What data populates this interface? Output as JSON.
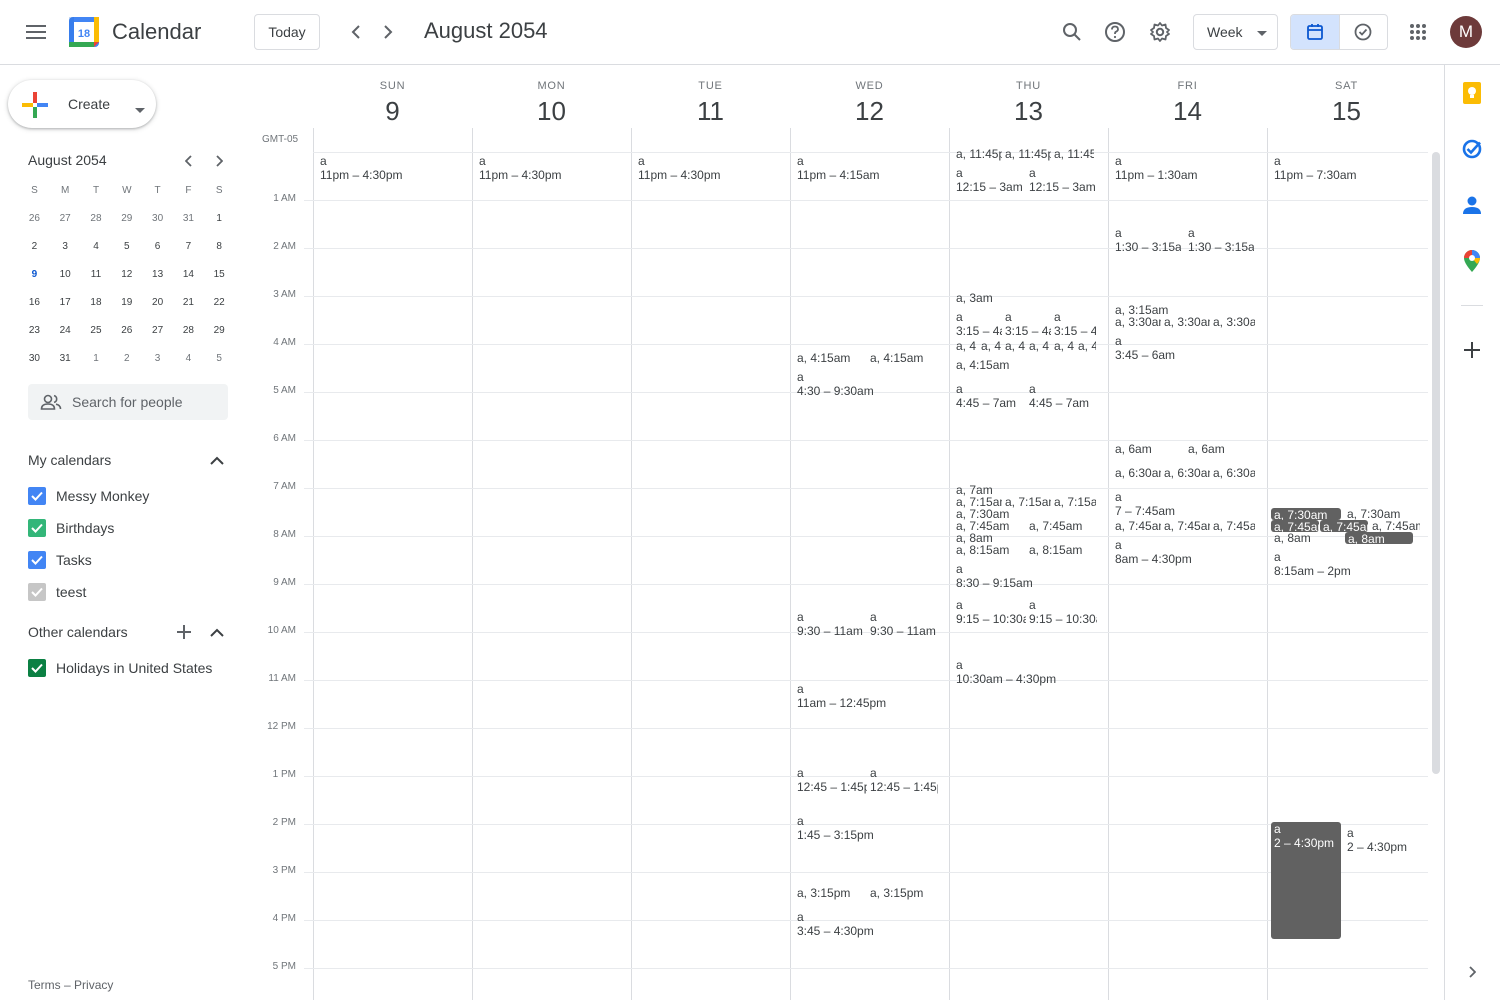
{
  "header": {
    "app_title": "Calendar",
    "logo_day": "18",
    "today_label": "Today",
    "period": "August 2054",
    "view_select": "Week",
    "avatar_letter": "M"
  },
  "sidebar": {
    "create_label": "Create",
    "mini_cal": {
      "title": "August 2054",
      "dow": [
        "S",
        "M",
        "T",
        "W",
        "T",
        "F",
        "S"
      ],
      "weeks": [
        [
          "26",
          "27",
          "28",
          "29",
          "30",
          "31",
          "1"
        ],
        [
          "2",
          "3",
          "4",
          "5",
          "6",
          "7",
          "8"
        ],
        [
          "9",
          "10",
          "11",
          "12",
          "13",
          "14",
          "15"
        ],
        [
          "16",
          "17",
          "18",
          "19",
          "20",
          "21",
          "22"
        ],
        [
          "23",
          "24",
          "25",
          "26",
          "27",
          "28",
          "29"
        ],
        [
          "30",
          "31",
          "1",
          "2",
          "3",
          "4",
          "5"
        ]
      ]
    },
    "search_people_placeholder": "Search for people",
    "my_calendars": {
      "title": "My calendars",
      "items": [
        {
          "label": "Messy Monkey",
          "color": "#4285f4",
          "checked": true
        },
        {
          "label": "Birthdays",
          "color": "#33b679",
          "checked": true
        },
        {
          "label": "Tasks",
          "color": "#4285f4",
          "checked": true
        },
        {
          "label": "teest",
          "color": "#c6c6c6",
          "checked": true
        }
      ]
    },
    "other_calendars": {
      "title": "Other calendars",
      "items": [
        {
          "label": "Holidays in United States",
          "color": "#0b8043",
          "checked": true
        }
      ]
    },
    "footer": {
      "terms": "Terms",
      "sep": "–",
      "privacy": "Privacy"
    }
  },
  "week": {
    "timezone": "GMT-05",
    "days": [
      {
        "dow": "SUN",
        "num": "9"
      },
      {
        "dow": "MON",
        "num": "10"
      },
      {
        "dow": "TUE",
        "num": "11"
      },
      {
        "dow": "WED",
        "num": "12"
      },
      {
        "dow": "THU",
        "num": "13"
      },
      {
        "dow": "FRI",
        "num": "14"
      },
      {
        "dow": "SAT",
        "num": "15"
      }
    ],
    "hours": [
      "1 AM",
      "2 AM",
      "3 AM",
      "4 AM",
      "5 AM",
      "6 AM",
      "7 AM",
      "8 AM",
      "9 AM",
      "10 AM",
      "11 AM",
      "12 PM",
      "1 PM",
      "2 PM",
      "3 PM",
      "4 PM",
      "5 PM"
    ]
  },
  "events": [
    {
      "day": 0,
      "title": "a",
      "time": "11pm – 4:30pm"
    },
    {
      "day": 1,
      "title": "a",
      "time": "11pm – 4:30pm"
    },
    {
      "day": 2,
      "title": "a",
      "time": "11pm – 4:30pm"
    },
    {
      "day": 3,
      "title": "a",
      "time": "11pm – 4:15am"
    },
    {
      "day": 3,
      "text": "a, 4:15am"
    },
    {
      "day": 3,
      "text": "a, 4:15am"
    },
    {
      "day": 3,
      "title": "a",
      "time": "4:30 – 9:30am"
    },
    {
      "day": 3,
      "title": "a",
      "time": "9:30 – 11am"
    },
    {
      "day": 3,
      "title": "a",
      "time": "9:30 – 11am"
    },
    {
      "day": 3,
      "title": "a",
      "time": "11am – 12:45pm"
    },
    {
      "day": 3,
      "title": "a",
      "time": "12:45 – 1:45pm"
    },
    {
      "day": 3,
      "title": "a",
      "time": "12:45 – 1:45pm"
    },
    {
      "day": 3,
      "title": "a",
      "time": "1:45 – 3:15pm"
    },
    {
      "day": 3,
      "text": "a, 3:15pm"
    },
    {
      "day": 3,
      "text": "a, 3:15pm"
    },
    {
      "day": 3,
      "title": "a",
      "time": "3:45 – 4:30pm"
    },
    {
      "day": 4,
      "text": "a, 11:45pm"
    },
    {
      "day": 4,
      "text": "a, 11:45pm"
    },
    {
      "day": 4,
      "text": "a, 11:45pm"
    },
    {
      "day": 4,
      "title": "a",
      "time": "12:15 – 3am"
    },
    {
      "day": 4,
      "title": "a",
      "time": "12:15 – 3am"
    },
    {
      "day": 4,
      "text": "a, 3am"
    },
    {
      "day": 4,
      "title": "a",
      "time": "3:15 – 4am"
    },
    {
      "day": 4,
      "title": "a",
      "time": "3:15 – 4am"
    },
    {
      "day": 4,
      "title": "a",
      "time": "3:15 – 4am"
    },
    {
      "day": 4,
      "text": "a, 4am"
    },
    {
      "day": 4,
      "text": "a, 4am"
    },
    {
      "day": 4,
      "text": "a, 4am"
    },
    {
      "day": 4,
      "text": "a, 4am"
    },
    {
      "day": 4,
      "text": "a, 4am"
    },
    {
      "day": 4,
      "text": "a, 4am"
    },
    {
      "day": 4,
      "text": "a, 4:15am"
    },
    {
      "day": 4,
      "title": "a",
      "time": "4:45 – 7am"
    },
    {
      "day": 4,
      "title": "a",
      "time": "4:45 – 7am"
    },
    {
      "day": 4,
      "text": "a, 7am"
    },
    {
      "day": 4,
      "text": "a, 7:15am"
    },
    {
      "day": 4,
      "text": "a, 7:15am"
    },
    {
      "day": 4,
      "text": "a, 7:15am"
    },
    {
      "day": 4,
      "text": "a, 7:30am"
    },
    {
      "day": 4,
      "text": "a, 7:45am"
    },
    {
      "day": 4,
      "text": "a, 7:45am"
    },
    {
      "day": 4,
      "text": "a, 8am"
    },
    {
      "day": 4,
      "text": "a, 8:15am"
    },
    {
      "day": 4,
      "text": "a, 8:15am"
    },
    {
      "day": 4,
      "title": "a",
      "time": "8:30 – 9:15am"
    },
    {
      "day": 4,
      "title": "a",
      "time": "9:15 – 10:30am"
    },
    {
      "day": 4,
      "title": "a",
      "time": "9:15 – 10:30am"
    },
    {
      "day": 4,
      "title": "a",
      "time": "10:30am – 4:30pm"
    },
    {
      "day": 5,
      "title": "a",
      "time": "11pm – 1:30am"
    },
    {
      "day": 5,
      "title": "a",
      "time": "1:30 – 3:15am"
    },
    {
      "day": 5,
      "title": "a",
      "time": "1:30 – 3:15am"
    },
    {
      "day": 5,
      "text": "a, 3:15am"
    },
    {
      "day": 5,
      "text": "a, 3:30am"
    },
    {
      "day": 5,
      "text": "a, 3:30am"
    },
    {
      "day": 5,
      "text": "a, 3:30am"
    },
    {
      "day": 5,
      "title": "a",
      "time": "3:45 – 6am"
    },
    {
      "day": 5,
      "text": "a, 6am"
    },
    {
      "day": 5,
      "text": "a, 6am"
    },
    {
      "day": 5,
      "text": "a, 6:30am"
    },
    {
      "day": 5,
      "text": "a, 6:30am"
    },
    {
      "day": 5,
      "text": "a, 6:30am"
    },
    {
      "day": 5,
      "title": "a",
      "time": "7 – 7:45am"
    },
    {
      "day": 5,
      "text": "a, 7:45am"
    },
    {
      "day": 5,
      "text": "a, 7:45am"
    },
    {
      "day": 5,
      "text": "a, 7:45am"
    },
    {
      "day": 5,
      "title": "a",
      "time": "8am – 4:30pm"
    },
    {
      "day": 6,
      "title": "a",
      "time": "11pm – 7:30am"
    },
    {
      "day": 6,
      "text": "a, 7:30am",
      "past": true
    },
    {
      "day": 6,
      "text": "a, 7:30am"
    },
    {
      "day": 6,
      "text": "a, 7:45am",
      "past": true
    },
    {
      "day": 6,
      "text": "a, 7:45am",
      "past": true
    },
    {
      "day": 6,
      "text": "a, 7:45am"
    },
    {
      "day": 6,
      "text": "a, 8am"
    },
    {
      "day": 6,
      "text": "a, 8am",
      "past": true
    },
    {
      "day": 6,
      "title": "a",
      "time": "8:15am – 2pm"
    },
    {
      "day": 6,
      "title": "a",
      "time": "2 – 4:30pm",
      "past": true
    },
    {
      "day": 6,
      "title": "a",
      "time": "2 – 4:30pm"
    }
  ]
}
